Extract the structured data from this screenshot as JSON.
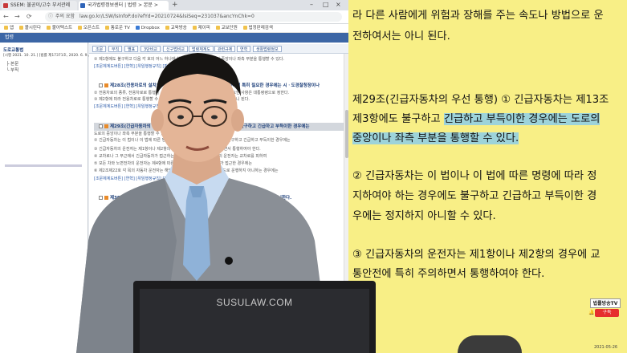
{
  "browser": {
    "tabs": [
      {
        "label": "SSEM: 불공이/고수 부서관례",
        "color": "#c83a3a"
      },
      {
        "label": "국가법령정보센터 | 법령 > 본문 >",
        "color": "#2f64b8"
      }
    ],
    "new_tab": "+",
    "window_controls": [
      "–",
      "□",
      "×"
    ],
    "nav": {
      "back": "←",
      "forward": "→",
      "reload": "⟳"
    },
    "url": "law.go.kr/LSW/lsInfoP.do?efYd=20210724&lsiSeq=231037&ancYnChk=0",
    "url_security": "주의 요함",
    "bookmarks": [
      "앱",
      "볼시린다",
      "불어텍스트",
      "오픈스트",
      "통로운 TV",
      "Dropbox",
      "교육방송",
      "제이피",
      "교보단원",
      "법정판례검색"
    ],
    "app_header": "법령",
    "left_panel": [
      "도로교통법",
      "[시행 2021. 10. 21.] [법률 제17371호, 2020. 6. 9., 일부개정]",
      "├ 본문",
      "└ 부칙"
    ],
    "doc_toolbar": [
      "조문",
      "부칙",
      "별표",
      "3단비교",
      "신구법비교",
      "법령체계도",
      "관련규제",
      "연혁",
      "생활법령정보"
    ],
    "doc_lines": [
      "② 제1항에도 불구하고 다음 각 호의 어느 하나에 해당하는 경우에는 도로의 중앙이나 좌측 부분을 통행할 수 있다.",
      "[조문체계도버튼] [연혁] [위임행정규칙] [판례]",
      "제28조(전용차로의 설치) ① 시장등은 원활한 교통을 확보하기 위하여 특히 필요한 경우에는 시ㆍ도경찰청장이나",
      "② 전용차로의 종류, 전용차로로 통행할 수 있는 차와 그 밖에 전용차로의 운영에 필요한 사항은 대통령령으로 정한다.",
      "③ 제2항에 따라 전용차로로 통행할 수 있는 차가 아니면 전용차로로 통행하여서는 아니 된다.",
      "[조문체계도버튼] [연혁] [위임행정규칙] [판례]",
      "제29조(긴급자동차의 우선 통행) ① 긴급자동차는 제13조제3항에도 불구하고 긴급하고 부득이한 경우에는",
      "도로의 중앙이나 좌측 부분을 통행할 수 있다.",
      "② 긴급자동차는 이 법이나 이 법에 따른 명령에 따라 정지하여야 하는 경우에도 불구하고 긴급하고 부득이한 경우에는",
      "③ 긴급자동차의 운전자는 제1항이나 제2항의 경우에 교통안전에 특히 주의하면서 통행하여야 한다.",
      "④ 교차로나 그 부근에서 긴급자동차가 접근하는 경우에는 차마와 노면전차의 운전자는 교차로를 피하여",
      "⑤ 모든 차와 노면전차의 운전자는 제4항에 따른 곳 외의 곳에서 긴급자동차가 접근한 경우에는",
      "⑥ 제2조제22호 각 목의 자동차 운전자는 해당 자동차를 그 본래의 긴급한 용도로 운행하지 아니하는 경우에는",
      "[조문체계도버튼] [연혁] [위임행정규칙] [판례]",
      "제30조(긴급자동차에 대한 특례) 긴급자동차에 대하여는 다음 각 호의 사항을 적용하지 아니한다."
    ]
  },
  "slide": {
    "background": "#f8ef86",
    "highlight_color": "#9dd3da",
    "lines": [
      {
        "text": "라 다른 사람에게 위험과 장해를 주는 속도나 방법으로 운"
      },
      {
        "text": "전하여서는 아니 된다."
      },
      {
        "text": "제29조(긴급자동차의 우선 통행) ① 긴급자동차는 제13조"
      },
      {
        "pre": "제3항에도 불구하고 ",
        "hl": "긴급하고 부득이한 경우에는 도로의"
      },
      {
        "hl": "중앙이나 좌측 부분을 통행할 수 있다."
      },
      {
        "text": "② 긴급자동차는 이 법이나 이 법에 따른 명령에 따라 정"
      },
      {
        "text": "지하여야 하는 경우에도 불구하고 긴급하고 부득이한 경"
      },
      {
        "text": "우에는 정지하지 아니할 수 있다."
      },
      {
        "text": "③ 긴급자동차의 운전자는 제1항이나 제2항의 경우에 교"
      },
      {
        "text": "통안전에 특히 주의하면서 통행하여야 한다."
      }
    ],
    "badge_mark": "법률방송TV",
    "badge_subscribe": "구독",
    "timestamp": "2021-05-26"
  },
  "monitor": {
    "brand": "SUSULAW.COM"
  }
}
